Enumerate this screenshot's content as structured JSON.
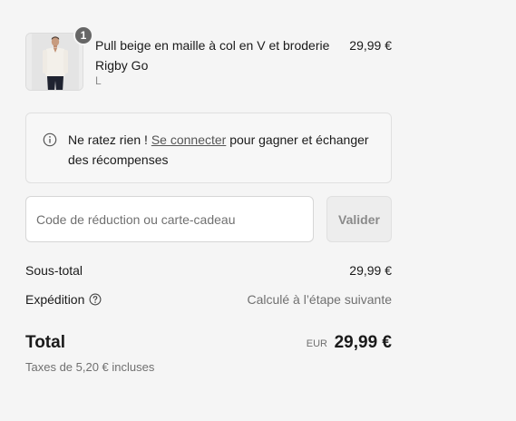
{
  "product": {
    "quantity": "1",
    "name": "Pull beige en maille à col en V et broderie Rigby Go",
    "variant": "L",
    "price": "29,99 €",
    "image_icon": "model-wearing-beige-sweater-photo"
  },
  "notice": {
    "icon": "info-icon",
    "text_before": "Ne ratez rien ! ",
    "link": "Se connecter",
    "text_after": " pour gagner et échanger des récompenses"
  },
  "discount": {
    "placeholder": "Code de réduction ou carte-cadeau",
    "value": "",
    "apply_label": "Valider"
  },
  "totals": {
    "subtotal_label": "Sous-total",
    "subtotal_value": "29,99 €",
    "shipping_label": "Expédition",
    "shipping_help_icon": "question-circle-icon",
    "shipping_value": "Calculé à l’étape suivante",
    "total_label": "Total",
    "currency": "EUR",
    "total_value": "29,99 €",
    "taxes_note": "Taxes de 5,20 € incluses"
  },
  "colors": {
    "background": "#f5f5f5",
    "text": "#1a1a1a",
    "muted": "#707070",
    "badge": "#666666"
  }
}
